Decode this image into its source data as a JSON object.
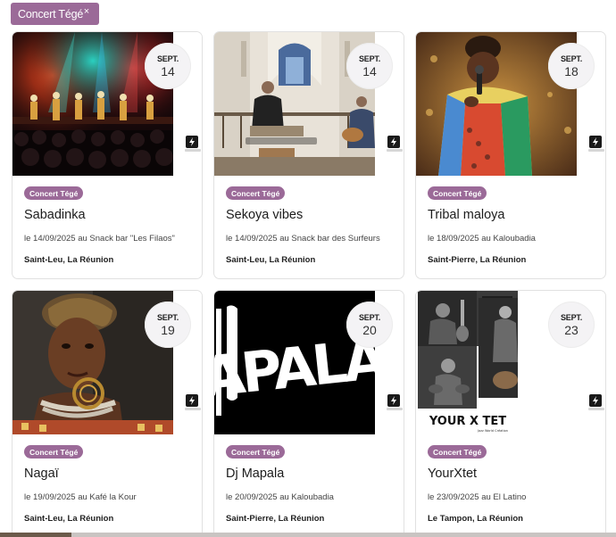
{
  "filter": {
    "label": "Concert Tégé",
    "close": "×"
  },
  "cards": [
    {
      "month": "SEPT.",
      "day": "14",
      "tag": "Concert Tégé",
      "title": "Sabadinka",
      "when": "le 14/09/2025  au Snack bar \"Les Filaos\"",
      "place": "Saint-Leu, La Réunion",
      "image": "concert-stage-photo"
    },
    {
      "month": "SEPT.",
      "day": "14",
      "tag": "Concert Tégé",
      "title": "Sekoya vibes",
      "when": "le 14/09/2025 au Snack bar des Surfeurs",
      "place": "Saint-Leu, La Réunion",
      "image": "church-musicians-photo"
    },
    {
      "month": "SEPT.",
      "day": "18",
      "tag": "Concert Tégé",
      "title": "Tribal maloya",
      "when": "le 18/09/2025 au Kaloubadia",
      "place": "Saint-Pierre, La Réunion",
      "image": "singer-microphone-photo"
    },
    {
      "month": "SEPT.",
      "day": "19",
      "tag": "Concert Tégé",
      "title": "Nagaï",
      "when": "le 19/09/2025 au Kafé la Kour",
      "place": "Saint-Leu, La Réunion",
      "image": "singer-portrait-photo"
    },
    {
      "month": "SEPT.",
      "day": "20",
      "tag": "Concert Tégé",
      "title": "Dj Mapala",
      "when": "le 20/09/2025 au Kaloubadia",
      "place": "Saint-Pierre, La Réunion",
      "image": "mapala-logo",
      "logo_text": "APALA"
    },
    {
      "month": "SEPT.",
      "day": "23",
      "tag": "Concert Tégé",
      "title": "YourXtet",
      "when": "le 23/09/2025 au El Latino",
      "place": "Le Tampon, La Réunion",
      "image": "band-collage-photo",
      "poster_text": "YOUR X TET",
      "poster_sub": "Jazz World Création"
    }
  ]
}
